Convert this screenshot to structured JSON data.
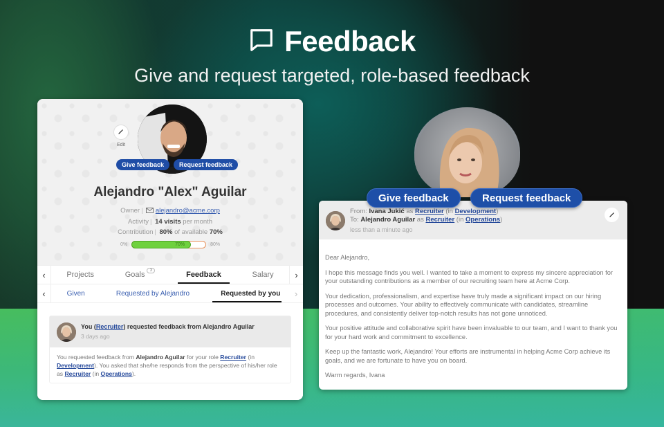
{
  "hero": {
    "icon": "message-square-icon",
    "title": "Feedback",
    "subtitle": "Give and request targeted, role-based feedback"
  },
  "colors": {
    "accent_blue": "#1f4da6",
    "link_blue": "#24489a",
    "progress_green": "#6fd13e",
    "progress_border": "#e8915a"
  },
  "profile": {
    "edit_label": "Edit",
    "give_feedback": "Give feedback",
    "request_feedback": "Request feedback",
    "name": "Alejandro \"Alex\" Aguilar",
    "owner_label": "Owner",
    "email": "alejandro@acme.corp",
    "activity_label": "Activity",
    "activity_value": "14 visits",
    "activity_suffix": "per month",
    "contribution_label": "Contribution",
    "contribution_value": "80%",
    "contribution_mid": "of available",
    "contribution_available": "70%",
    "progress": {
      "min_label": "0%",
      "value_label": "70%",
      "max_label": "80%",
      "value_percent": 70,
      "max_percent": 80
    }
  },
  "tabs": {
    "items": [
      {
        "label": "Projects",
        "active": false
      },
      {
        "label": "Goals",
        "badge": "3",
        "active": false
      },
      {
        "label": "Feedback",
        "active": true
      },
      {
        "label": "Salary",
        "active": false
      }
    ]
  },
  "subtabs": {
    "items": [
      {
        "label": "Given",
        "active": false
      },
      {
        "label": "Requested by Alejandro",
        "active": false
      },
      {
        "label": "Requested by you",
        "active": true
      }
    ]
  },
  "request_card": {
    "title_you": "You (",
    "title_role": "Recruiter",
    "title_rest": ") requested feedback from Alejandro Aguilar",
    "time": "3 days ago",
    "body": {
      "t1": "You requested feedback from ",
      "person": "Alejandro Aguilar",
      "t2": " for your role ",
      "role1": "Recruiter",
      "t3": " (in ",
      "dept1": "Development",
      "t4": "). You asked that she/he responds from the perspective of his/her role as ",
      "role2": "Recruiter",
      "t5": " (in ",
      "dept2": "Operations",
      "t6": ")."
    }
  },
  "message": {
    "give_feedback": "Give feedback",
    "request_feedback": "Request feedback",
    "from_label": "From: ",
    "from_name": "Ivana Jukić",
    "as": " as ",
    "from_role": "Recruiter",
    "in_open": " (in ",
    "from_dept": "Development",
    "close": ")",
    "to_label": "To: ",
    "to_name": "Alejandro Aguilar",
    "to_role": "Recruiter",
    "to_dept": "Operations",
    "time": "less than a minute ago",
    "paragraphs": [
      "Dear Alejandro,",
      "I hope this message finds you well. I wanted to take a moment to express my sincere appreciation for your outstanding contributions as a member of our recruiting team here at Acme Corp.",
      "Your dedication, professionalism, and expertise have truly made a significant impact on our hiring processes and outcomes. Your ability to effectively communicate with candidates, streamline procedures, and consistently deliver top-notch results has not gone unnoticed.",
      "Your positive attitude and collaborative spirit have been invaluable to our team, and I want to thank you for your hard work and commitment to excellence.",
      "Keep up the fantastic work, Alejandro! Your efforts are instrumental in helping Acme Corp achieve its goals, and we are fortunate to have you on board.",
      "Warm regards, Ivana"
    ]
  }
}
